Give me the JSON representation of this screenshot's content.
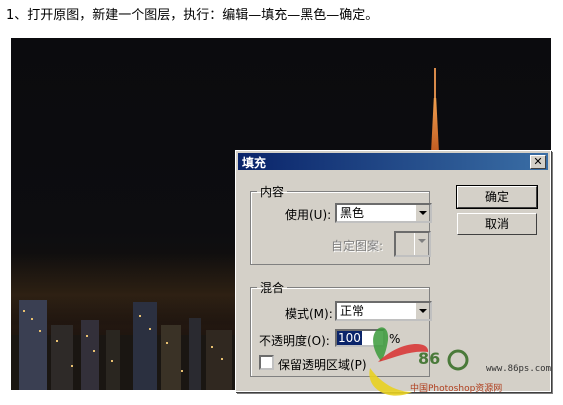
{
  "instruction": "1、打开原图，新建一个图层，执行：编辑—填充—黑色—确定。",
  "dialog": {
    "title": "填充",
    "close_symbol": "✕",
    "contents_group": "内容",
    "use_label": "使用(U):",
    "use_value": "黑色",
    "custom_pattern_label": "自定图案:",
    "blend_group": "混合",
    "mode_label": "模式(M):",
    "mode_value": "正常",
    "opacity_label": "不透明度(O):",
    "opacity_value": "100",
    "opacity_unit": "%",
    "preserve_label": "保留透明区域(P)",
    "ok_label": "确定",
    "cancel_label": "取消"
  },
  "watermark": {
    "number": "86",
    "url": "www.86ps.com",
    "site": "中国Photoshop资源网"
  }
}
